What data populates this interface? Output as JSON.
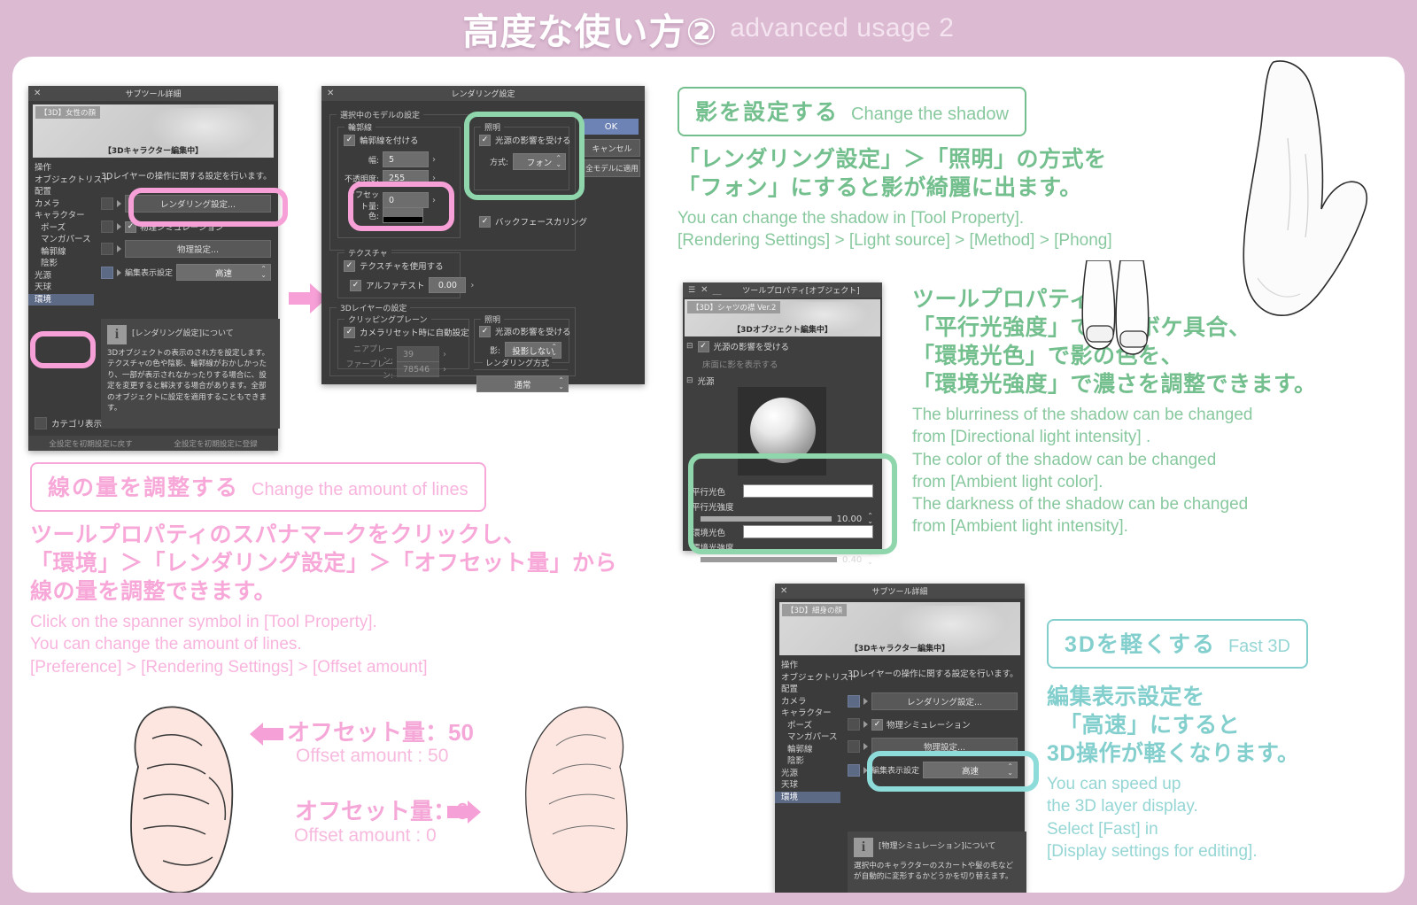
{
  "header": {
    "title_jp": "高度な使い方②",
    "title_en": "advanced usage 2"
  },
  "dialog_subtool_1": {
    "window_title": "サブツール詳細",
    "close_icon": "close-icon",
    "preview_tag": "【3D】女性の顔",
    "preview_caption": "【3Dキャラクター編集中】",
    "categories": [
      "操作",
      "オブジェクトリスト",
      "配置",
      "カメラ",
      "キャラクター",
      "ポーズ",
      "マンガパース",
      "輪郭線",
      "陰影",
      "光源",
      "天球",
      "環境"
    ],
    "selected_category": "環境",
    "description": "3Dレイヤーの操作に関する設定を行います。",
    "render_settings_button": "レンダリング設定...",
    "physics_sim_checkbox": "物理シミュレーション",
    "physics_settings_button": "物理設定...",
    "edit_display_label": "編集表示設定",
    "edit_display_value": "高速",
    "info_title": "[レンダリング設定]について",
    "info_body": "3Dオブジェクトの表示のされ方を設定します。テクスチャの色や陰影、輪郭線がおかしかったり、一部が表示されなかったりする場合に、設定を変更すると解決する場合があります。全部のオブジェクトに設定を適用することもできます。",
    "category_display_checkbox": "カテゴリ表示",
    "footer_reset": "全設定を初期設定に戻す",
    "footer_register": "全設定を初期設定に登録"
  },
  "dialog_rendering": {
    "window_title": "レンダリング設定",
    "close_icon": "close-icon",
    "group_model": "選択中のモデルの設定",
    "group_outline": "輪郭線",
    "outline_checkbox": "輪郭線を付ける",
    "width_label": "幅:",
    "width_value": "5",
    "opacity_label": "不透明度:",
    "opacity_value": "255",
    "offset_label": "オフセット量:",
    "offset_value": "0",
    "color_label": "色:",
    "group_texture": "テクスチャ",
    "texture_checkbox": "テクスチャを使用する",
    "alpha_checkbox": "アルファテスト",
    "alpha_value": "0.00",
    "group_light": "照明",
    "light_checkbox": "光源の影響を受ける",
    "method_label": "方式:",
    "method_value": "フォン",
    "backface_checkbox": "バックフェースカリング",
    "group_3dlayer": "3Dレイヤーの設定",
    "group_clipping": "クリッピングプレーン",
    "auto_clip_checkbox": "カメラリセット時に自動設定",
    "near_label": "ニアプレーン:",
    "near_value": "39",
    "far_label": "ファープレーン:",
    "far_value": "78546",
    "group_light2": "照明",
    "light2_checkbox": "光源の影響を受ける",
    "shadow_label": "影:",
    "shadow_value": "投影しない",
    "group_render_method": "レンダリング方式",
    "render_method_value": "通常",
    "btn_ok": "OK",
    "btn_cancel": "キャンセル",
    "btn_apply_all": "全モデルに適用"
  },
  "callout_shadow": {
    "badge_jp": "影を設定する",
    "badge_en": "Change the shadow",
    "lead_line1": "「レンダリング設定」＞「照明」の方式を",
    "lead_line2": "「フォン」にすると影が綺麗に出ます。",
    "sub_line1": "You can change the shadow in [Tool Property].",
    "sub_line2": "[Rendering Settings] > [Light source] > [Method] > [Phong]",
    "color": "#74bf8e"
  },
  "dialog_toolproperty": {
    "window_title": "ツールプロパティ[オブジェクト]",
    "menu_icon": "hamburger-icon",
    "close_icon": "close-icon",
    "minimize_icon": "minimize-icon",
    "preview_tag": "【3D】シャツの襟 Ver.2",
    "preview_caption": "【3Dオブジェクト編集中】",
    "light_affect_checkbox": "光源の影響を受ける",
    "floor_shadow_label": "床面に影を表示する",
    "light_section": "光源",
    "directional_color_label": "平行光色",
    "directional_intensity_label": "平行光強度",
    "directional_intensity_value": "10.00",
    "ambient_color_label": "環境光色",
    "ambient_intensity_label": "環境光強度",
    "ambient_intensity_value": "0.40"
  },
  "callout_toolprop": {
    "lead_line1": "ツールプロパティ内の",
    "lead_line2": "「平行光強度」で影のボケ具合、",
    "lead_line3": "「環境光色」で影の色を、",
    "lead_line4": "「環境光強度」で濃さを調整できます。",
    "sub_line1": "The blurriness of the shadow can be changed",
    "sub_line2": "from [Directional light intensity] .",
    "sub_line3": "The color of the shadow can be changed",
    "sub_line4": "from [Ambient light color].",
    "sub_line5": "The darkness of the shadow can be changed",
    "sub_line6": "from [Ambient light intensity].",
    "color": "#74bf8e"
  },
  "callout_lines": {
    "badge_jp": "線の量を調整する",
    "badge_en": "Change the amount of lines",
    "lead_line1": "ツールプロパティのスパナマークをクリックし、",
    "lead_line2": "「環境」＞「レンダリング設定」＞「オフセット量」から",
    "lead_line3": "線の量を調整できます。",
    "sub_line1": "Click on the spanner symbol in [Tool Property].",
    "sub_line2": "You can change the amount of lines.",
    "sub_line3": "[Preference] > [Rendering Settings] > [Offset amount]",
    "color": "#f7a8d8"
  },
  "offset_labels": {
    "left_arrow_icon": "arrow-left-icon",
    "right_arrow_icon": "arrow-right-icon",
    "a_jp": "オフセット量：50",
    "a_en": "Offset amount : 50",
    "b_jp": "オフセット量：0",
    "b_en": "Offset amount : 0"
  },
  "dialog_subtool_2": {
    "window_title": "サブツール詳細",
    "close_icon": "close-icon",
    "preview_tag": "【3D】細身の顔",
    "preview_caption": "【3Dキャラクター編集中】",
    "categories": [
      "操作",
      "オブジェクトリスト",
      "配置",
      "カメラ",
      "キャラクター",
      "ポーズ",
      "マンガパース",
      "輪郭線",
      "陰影",
      "光源",
      "天球",
      "環境"
    ],
    "selected_category": "環境",
    "description": "3Dレイヤーの操作に関する設定を行います。",
    "render_settings_button": "レンダリング設定...",
    "physics_sim_checkbox": "物理シミュレーション",
    "physics_settings_button": "物理設定...",
    "edit_display_label": "編集表示設定",
    "edit_display_value": "高速",
    "info_title": "[物理シミュレーション]について",
    "info_body": "選択中のキャラクターのスカートや髪の毛などが自動的に変形するかどうかを切り替えます。"
  },
  "callout_fast3d": {
    "badge_jp": "3Dを軽くする",
    "badge_en": "Fast 3D",
    "lead_line1": "編集表示設定を",
    "lead_line2": "「高速」にすると",
    "lead_line3": "3D操作が軽くなります。",
    "sub_line1": "You can speed up",
    "sub_line2": "the 3D layer display.",
    "sub_line3": "Select [Fast] in",
    "sub_line4": "[Display settings for editing].",
    "color": "#83cfce"
  },
  "theme": {
    "background": "#dcbad2",
    "card": "#ffffff",
    "pink": "#f7a0d8",
    "green": "#8fd6ad",
    "teal": "#8ddcd9"
  }
}
